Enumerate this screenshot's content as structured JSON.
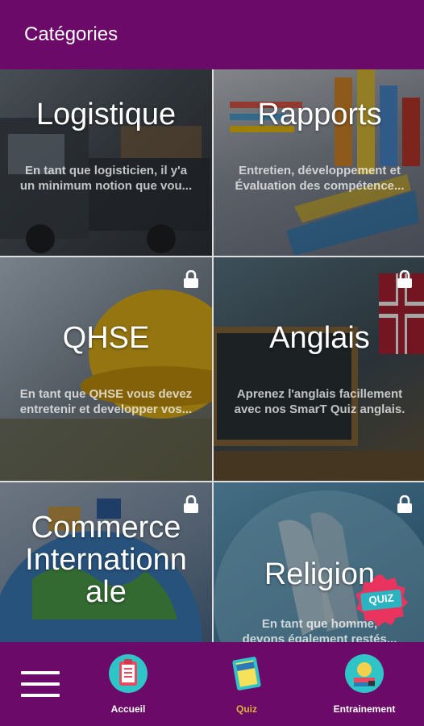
{
  "appbar": {
    "title": "Catégories"
  },
  "categories": [
    {
      "title": "Logistique",
      "desc": "En tant que logisticien, il y'a\nun minimum notion que vou...",
      "locked": false
    },
    {
      "title": "Rapports",
      "desc": "Entretien, développement et\nÉvaluation des compétence...",
      "locked": false
    },
    {
      "title": "QHSE",
      "desc": "En tant que QHSE vous devez\nentretenir et developper vos...",
      "locked": true
    },
    {
      "title": "Anglais",
      "desc": "Aprenez l'anglais facillement\navec nos SmarT Quiz anglais.",
      "locked": true
    },
    {
      "title": "Commerce\nInternationn\nale",
      "desc": "",
      "locked": true
    },
    {
      "title": "Religion",
      "desc": "En tant que homme,\ndevons également restés...",
      "locked": true
    }
  ],
  "badge": {
    "label": "QUIZ"
  },
  "nav": {
    "items": [
      {
        "label": "Accueil"
      },
      {
        "label": "Quiz",
        "active": true
      },
      {
        "label": "Entrainement"
      }
    ]
  },
  "colors": {
    "primary": "#6b0a68",
    "active_nav": "#e0b23a"
  }
}
